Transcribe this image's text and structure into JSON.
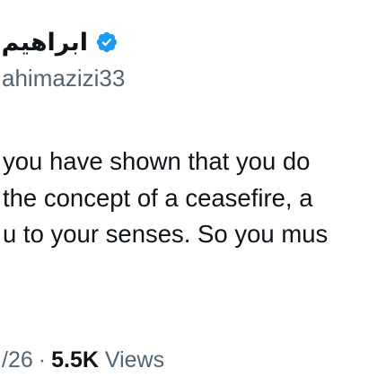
{
  "user": {
    "display_name": "ابراهيم",
    "handle": "ahimazizi33",
    "verified": true,
    "verified_color": "#1d9bf0"
  },
  "tweet": {
    "lines": [
      "you have shown that you do",
      "the concept of a ceasefire, a",
      "u to your senses. So you mus"
    ]
  },
  "meta": {
    "date_fragment": "/26",
    "separator": "·",
    "views_count": "5.5K",
    "views_label": "Views"
  }
}
